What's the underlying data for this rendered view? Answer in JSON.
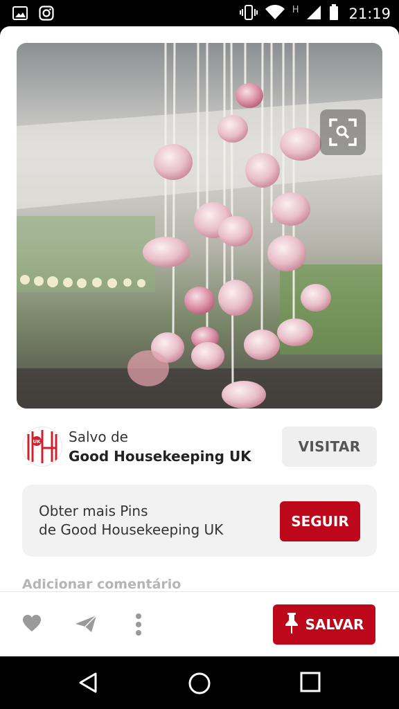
{
  "status_bar": {
    "time": "21:19",
    "network_letter": "H",
    "left_icons": [
      "gallery-icon",
      "instagram-icon"
    ],
    "right_icons": [
      "vibrate-icon",
      "wifi-icon",
      "signal-icon",
      "battery-icon"
    ]
  },
  "pin": {
    "image_icon": "visual-search-icon"
  },
  "source": {
    "saved_from": "Salvo de",
    "name": "Good Housekeeping UK",
    "avatar_text": "GH",
    "avatar_badge": "UK",
    "visit_label": "VISITAR"
  },
  "follow": {
    "line1": "Obter mais Pins",
    "line2": "de Good Housekeeping UK",
    "button_label": "SEGUIR"
  },
  "comment": {
    "placeholder": "Adicionar comentário"
  },
  "actions": {
    "save_label": "SALVAR",
    "icons": [
      "heart-icon",
      "send-icon",
      "more-icon",
      "pin-icon"
    ]
  },
  "colors": {
    "brand_red": "#bd081c",
    "light_gray": "#f2f2f2"
  },
  "nav": {
    "buttons": [
      "back-icon",
      "home-icon",
      "recents-icon"
    ]
  }
}
